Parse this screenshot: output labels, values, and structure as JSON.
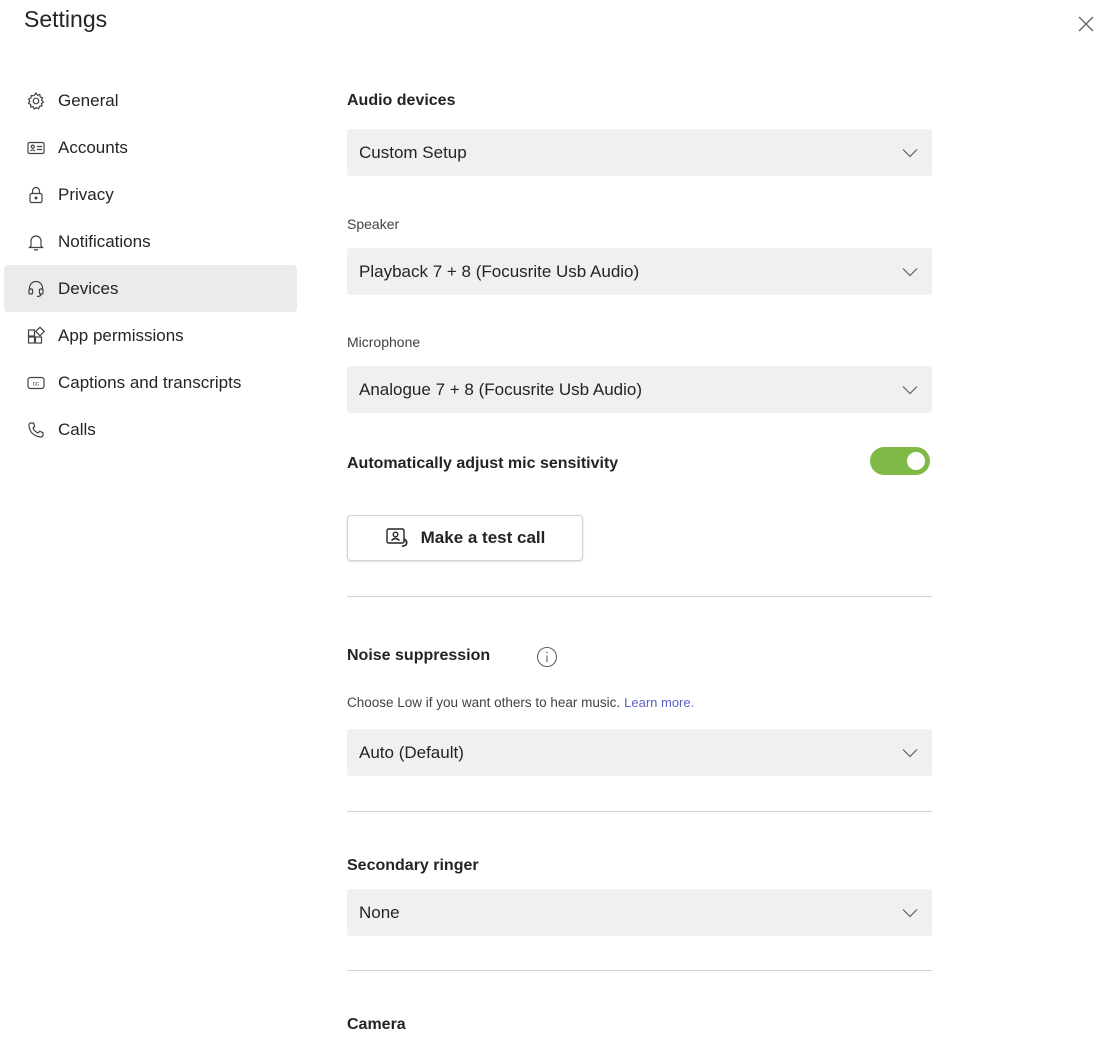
{
  "window": {
    "title": "Settings"
  },
  "sidebar": {
    "items": [
      {
        "label": "General",
        "icon": "gear-icon"
      },
      {
        "label": "Accounts",
        "icon": "id-card-icon"
      },
      {
        "label": "Privacy",
        "icon": "lock-icon"
      },
      {
        "label": "Notifications",
        "icon": "bell-icon"
      },
      {
        "label": "Devices",
        "icon": "headset-icon",
        "active": true
      },
      {
        "label": "App permissions",
        "icon": "apps-icon"
      },
      {
        "label": "Captions and transcripts",
        "icon": "captions-icon"
      },
      {
        "label": "Calls",
        "icon": "phone-icon"
      }
    ]
  },
  "audio": {
    "heading": "Audio devices",
    "device_value": "Custom Setup",
    "speaker_label": "Speaker",
    "speaker_value": "Playback 7 + 8 (Focusrite Usb Audio)",
    "mic_label": "Microphone",
    "mic_value": "Analogue 7 + 8 (Focusrite Usb Audio)",
    "auto_adjust_label": "Automatically adjust mic sensitivity",
    "auto_adjust_on": true,
    "test_call_label": "Make a test call"
  },
  "noise": {
    "heading": "Noise suppression",
    "helper": "Choose Low if you want others to hear music.",
    "learn_more": "Learn more.",
    "value": "Auto (Default)"
  },
  "ringer": {
    "heading": "Secondary ringer",
    "value": "None"
  },
  "camera": {
    "heading": "Camera"
  },
  "colors": {
    "toggle_on": "#7fba47",
    "link": "#5b5fc7",
    "active_nav_bg": "#ebebeb",
    "dropdown_bg": "#f0f0f0"
  }
}
